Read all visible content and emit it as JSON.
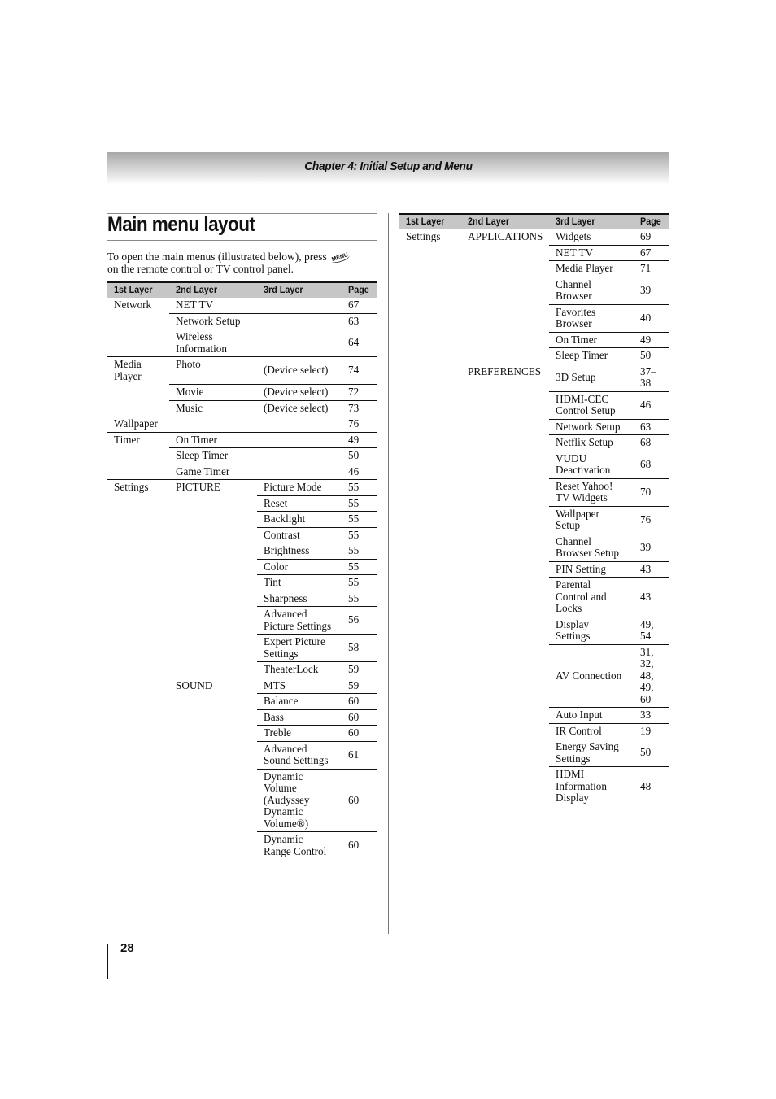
{
  "header": {
    "chapter": "Chapter 4: Initial Setup and Menu"
  },
  "title": "Main menu layout",
  "intro": {
    "text_before": "To open the main menus (illustrated below), press",
    "menu_icon": "MENU",
    "text_after": "on the remote control or TV control panel."
  },
  "columns": {
    "c1": "1st Layer",
    "c2": "2nd Layer",
    "c3": "3rd Layer",
    "c4": "Page"
  },
  "left_table": {
    "rows": [
      {
        "l1": "Network",
        "l2": "NET TV",
        "l3": "",
        "page": "67"
      },
      {
        "l1": "",
        "l2": "Network Setup",
        "l3": "",
        "page": "63"
      },
      {
        "l1": "",
        "l2": "Wireless\nInformation",
        "l3": "",
        "page": "64"
      },
      {
        "l1": "Media\nPlayer",
        "l2": "Photo",
        "l3": "(Device select)",
        "page": "74"
      },
      {
        "l1": "",
        "l2": "Movie",
        "l3": "(Device select)",
        "page": "72"
      },
      {
        "l1": "",
        "l2": "Music",
        "l3": "(Device select)",
        "page": "73"
      },
      {
        "l1": "Wallpaper",
        "l2": "",
        "l3": "",
        "page": "76"
      },
      {
        "l1": "Timer",
        "l2": "On Timer",
        "l3": "",
        "page": "49"
      },
      {
        "l1": "",
        "l2": "Sleep Timer",
        "l3": "",
        "page": "50"
      },
      {
        "l1": "",
        "l2": "Game Timer",
        "l3": "",
        "page": "46"
      },
      {
        "l1": "Settings",
        "l2": "PICTURE",
        "l3": "Picture Mode",
        "page": "55"
      },
      {
        "l1": "",
        "l2": "",
        "l3": "Reset",
        "page": "55"
      },
      {
        "l1": "",
        "l2": "",
        "l3": "Backlight",
        "page": "55"
      },
      {
        "l1": "",
        "l2": "",
        "l3": "Contrast",
        "page": "55"
      },
      {
        "l1": "",
        "l2": "",
        "l3": "Brightness",
        "page": "55"
      },
      {
        "l1": "",
        "l2": "",
        "l3": "Color",
        "page": "55"
      },
      {
        "l1": "",
        "l2": "",
        "l3": "Tint",
        "page": "55"
      },
      {
        "l1": "",
        "l2": "",
        "l3": "Sharpness",
        "page": "55"
      },
      {
        "l1": "",
        "l2": "",
        "l3": "Advanced\nPicture Settings",
        "page": "56"
      },
      {
        "l1": "",
        "l2": "",
        "l3": "Expert Picture\nSettings",
        "page": "58"
      },
      {
        "l1": "",
        "l2": "",
        "l3": "TheaterLock",
        "page": "59"
      },
      {
        "l1": "",
        "l2": "SOUND",
        "l3": "MTS",
        "page": "59"
      },
      {
        "l1": "",
        "l2": "",
        "l3": "Balance",
        "page": "60"
      },
      {
        "l1": "",
        "l2": "",
        "l3": "Bass",
        "page": "60"
      },
      {
        "l1": "",
        "l2": "",
        "l3": "Treble",
        "page": "60"
      },
      {
        "l1": "",
        "l2": "",
        "l3": "Advanced\nSound Settings",
        "page": "61"
      },
      {
        "l1": "",
        "l2": "",
        "l3": "Dynamic\nVolume\n(Audyssey\nDynamic\nVolume®)",
        "page": "60"
      },
      {
        "l1": "",
        "l2": "",
        "l3": "Dynamic\nRange Control",
        "page": "60"
      }
    ]
  },
  "right_table": {
    "rows": [
      {
        "l1": "Settings",
        "l2": "APPLICATIONS",
        "l3": "Widgets",
        "page": "69"
      },
      {
        "l1": "",
        "l2": "",
        "l3": "NET TV",
        "page": "67"
      },
      {
        "l1": "",
        "l2": "",
        "l3": "Media Player",
        "page": "71"
      },
      {
        "l1": "",
        "l2": "",
        "l3": "Channel\nBrowser",
        "page": "39"
      },
      {
        "l1": "",
        "l2": "",
        "l3": "Favorites\nBrowser",
        "page": "40"
      },
      {
        "l1": "",
        "l2": "",
        "l3": "On Timer",
        "page": "49"
      },
      {
        "l1": "",
        "l2": "",
        "l3": "Sleep Timer",
        "page": "50"
      },
      {
        "l1": "",
        "l2": "PREFERENCES",
        "l3": "3D Setup",
        "page": "37–\n38"
      },
      {
        "l1": "",
        "l2": "",
        "l3": "HDMI-CEC\nControl Setup",
        "page": "46"
      },
      {
        "l1": "",
        "l2": "",
        "l3": "Network Setup",
        "page": "63"
      },
      {
        "l1": "",
        "l2": "",
        "l3": "Netflix Setup",
        "page": "68"
      },
      {
        "l1": "",
        "l2": "",
        "l3": "VUDU\nDeactivation",
        "page": "68"
      },
      {
        "l1": "",
        "l2": "",
        "l3": "Reset Yahoo!\nTV Widgets",
        "page": "70"
      },
      {
        "l1": "",
        "l2": "",
        "l3": "Wallpaper\nSetup",
        "page": "76"
      },
      {
        "l1": "",
        "l2": "",
        "l3": "Channel\nBrowser Setup",
        "page": "39"
      },
      {
        "l1": "",
        "l2": "",
        "l3": "PIN Setting",
        "page": "43"
      },
      {
        "l1": "",
        "l2": "",
        "l3": "Parental\nControl and\nLocks",
        "page": "43"
      },
      {
        "l1": "",
        "l2": "",
        "l3": "Display\nSettings",
        "page": "49,\n54"
      },
      {
        "l1": "",
        "l2": "",
        "l3": "AV Connection",
        "page": "31,\n32,\n48,\n49,\n60"
      },
      {
        "l1": "",
        "l2": "",
        "l3": "Auto Input",
        "page": "33"
      },
      {
        "l1": "",
        "l2": "",
        "l3": "IR Control",
        "page": "19"
      },
      {
        "l1": "",
        "l2": "",
        "l3": "Energy Saving\nSettings",
        "page": "50"
      },
      {
        "l1": "",
        "l2": "",
        "l3": "HDMI\nInformation\nDisplay",
        "page": "48"
      }
    ]
  },
  "footer": {
    "page_number": "28"
  }
}
